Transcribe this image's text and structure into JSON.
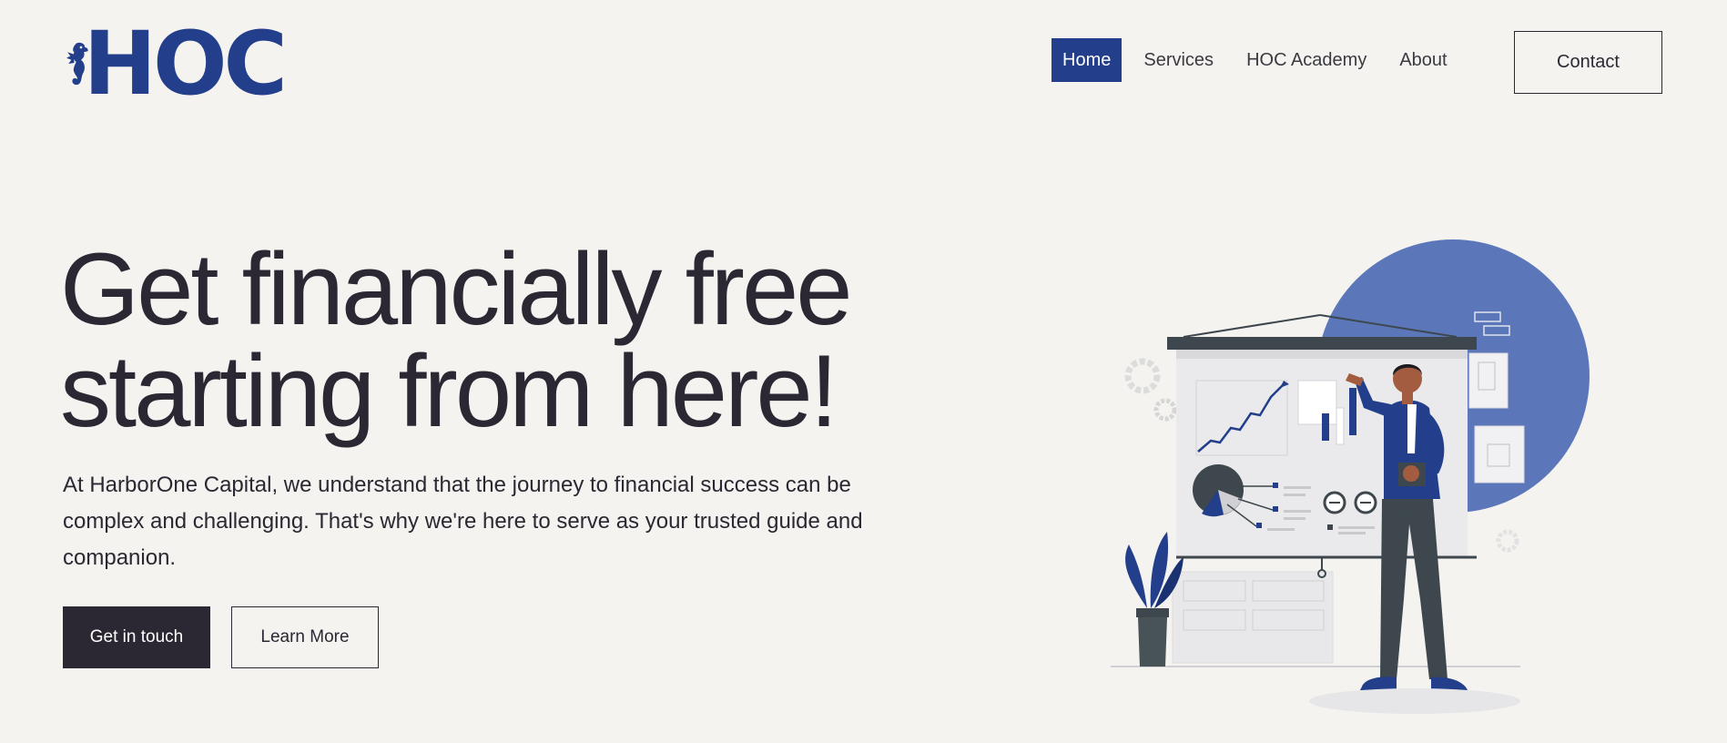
{
  "brand": {
    "logo_text": "HOC",
    "accent_color": "#233f8b"
  },
  "nav": {
    "items": [
      {
        "label": "Home",
        "active": true
      },
      {
        "label": "Services",
        "active": false
      },
      {
        "label": "HOC Academy",
        "active": false
      },
      {
        "label": "About",
        "active": false
      }
    ],
    "contact_label": "Contact"
  },
  "hero": {
    "title_line1": "Get financially free",
    "title_line2": "starting from here!",
    "description": "At HarborOne Capital, we understand that the journey to financial success can be complex and challenging. That's why we're here to serve as your trusted guide and companion.",
    "primary_button": "Get in touch",
    "secondary_button": "Learn More"
  },
  "illustration": {
    "icon": "businessman-presenting-chart-illustration",
    "circle_color": "#5b77ba"
  }
}
